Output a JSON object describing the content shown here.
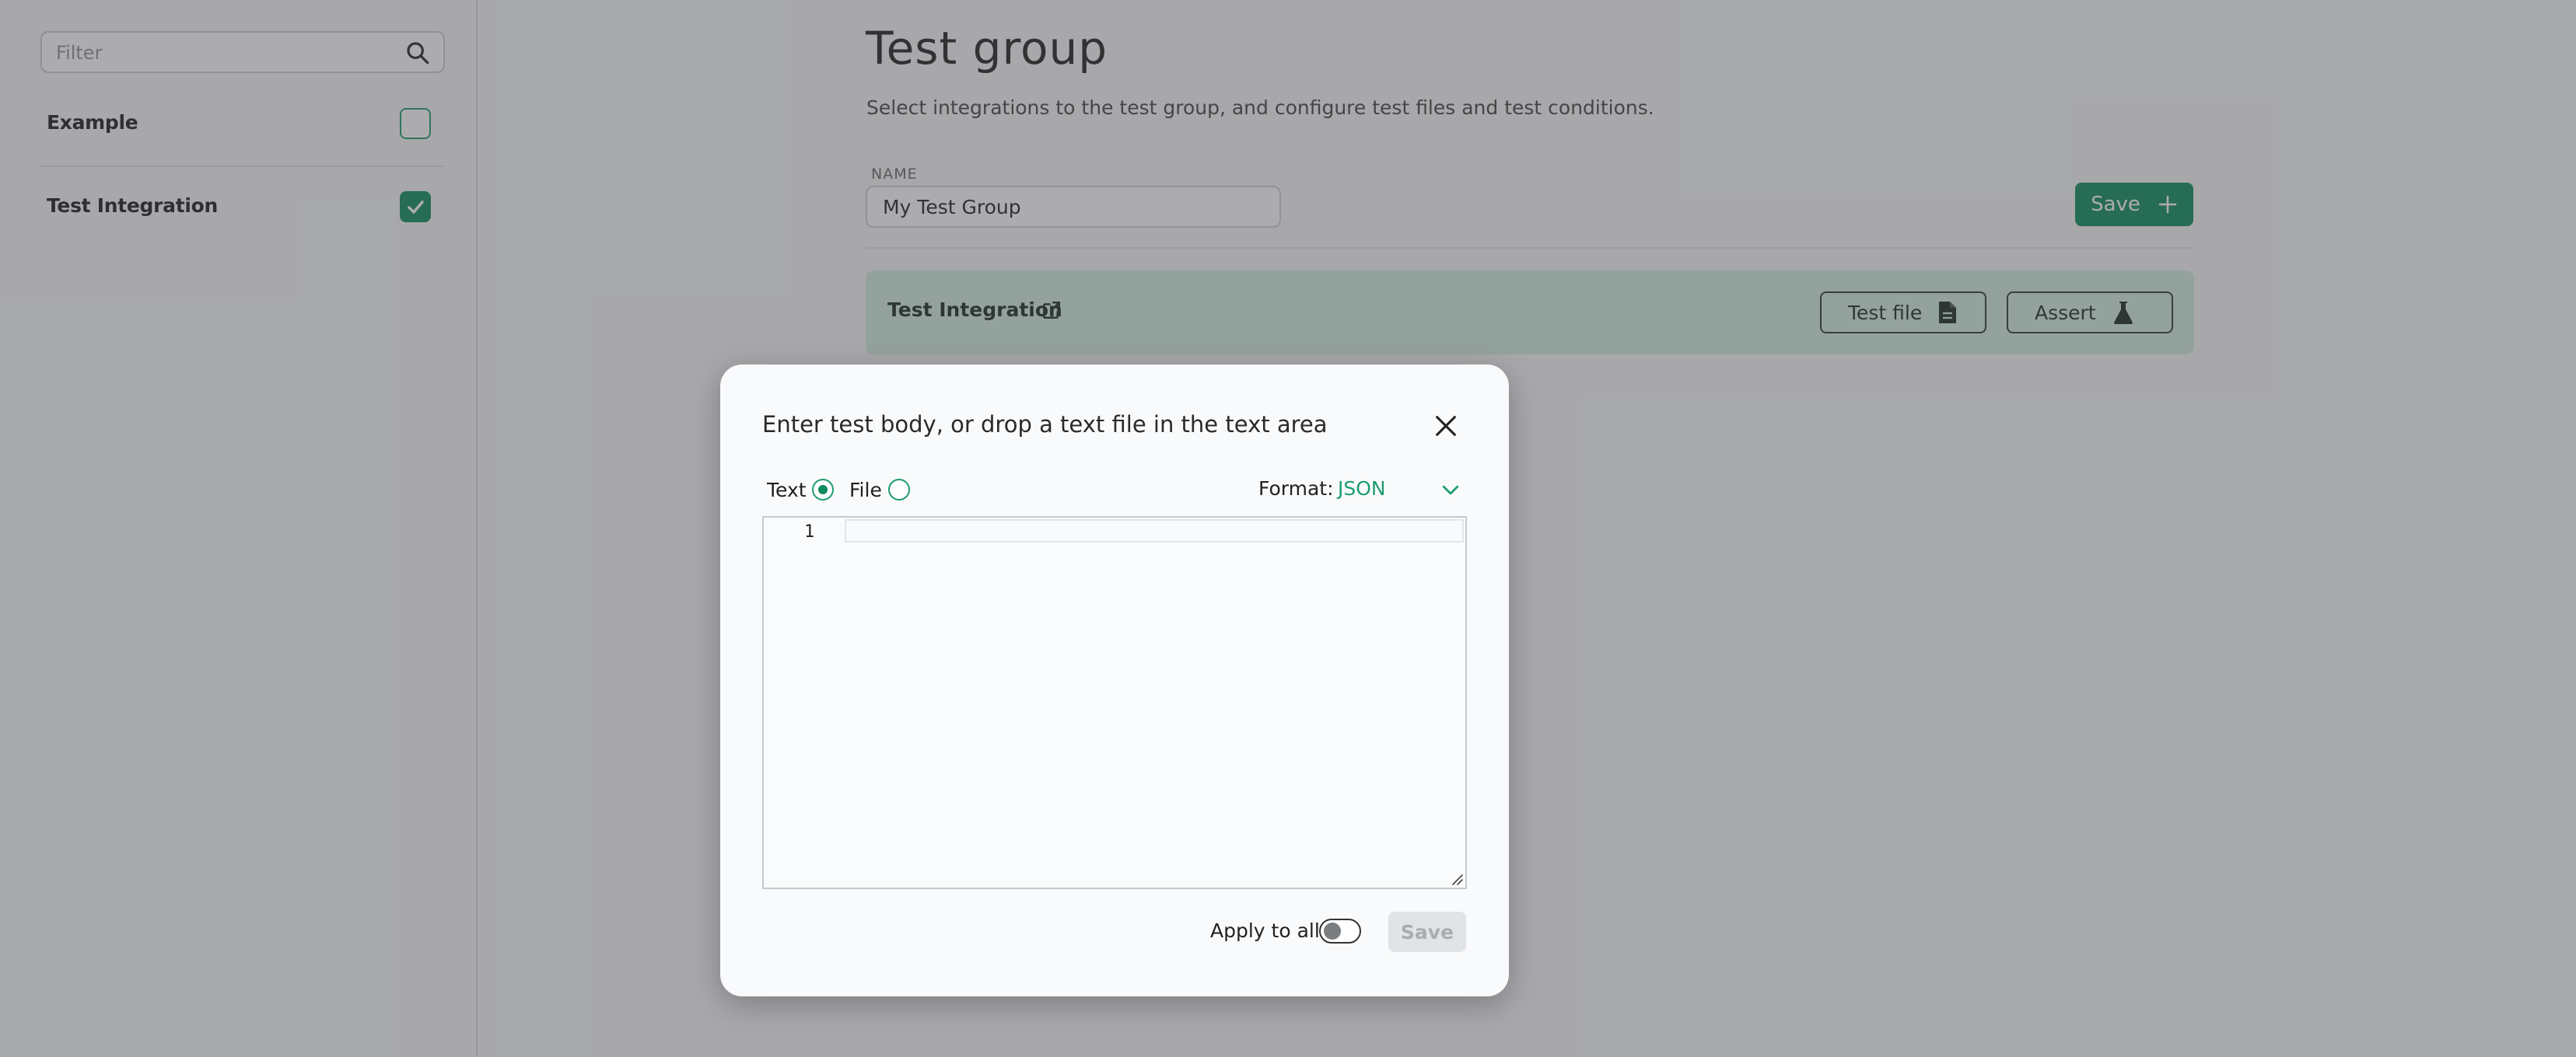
{
  "sidebar": {
    "filter_placeholder": "Filter",
    "items": [
      {
        "label": "Example",
        "checked": false
      },
      {
        "label": "Test Integration",
        "checked": true
      }
    ]
  },
  "main": {
    "title": "Test group",
    "subtitle": "Select integrations to the test group, and configure test files and test conditions.",
    "name_label": "NAME",
    "name_value": "My Test Group",
    "save_label": "Save",
    "integration": {
      "name": "Test Integration",
      "test_file_label": "Test file",
      "assert_label": "Assert"
    }
  },
  "modal": {
    "title": "Enter test body, or drop a text file in the text area",
    "text_option": "Text",
    "file_option": "File",
    "selected_option": "Text",
    "format_label": "Format:",
    "format_value": "JSON",
    "line_number": "1",
    "apply_to_all_label": "Apply to all",
    "apply_to_all_on": false,
    "save_label": "Save"
  },
  "colors": {
    "accent": "#0e8a5c",
    "accent_text": "#1e9c70",
    "card_bg": "#d3ede0",
    "overlay": "rgba(70,72,76,0.45)"
  }
}
